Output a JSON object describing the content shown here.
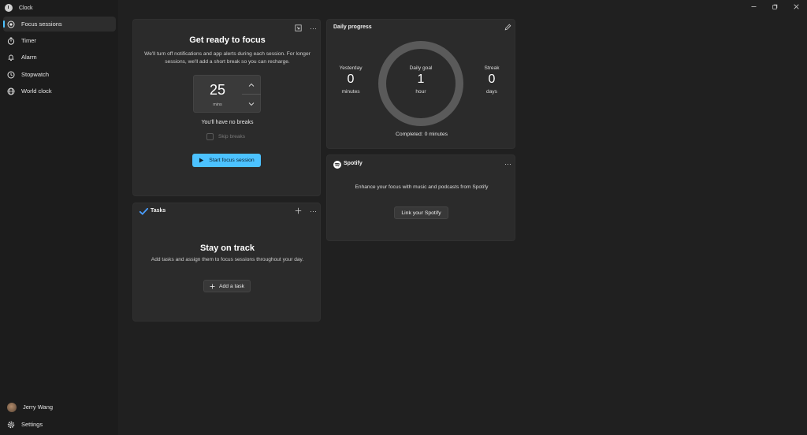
{
  "app": {
    "title": "Clock"
  },
  "sidebar": {
    "items": [
      {
        "label": "Focus sessions",
        "active": true,
        "icon": "focus-icon"
      },
      {
        "label": "Timer",
        "active": false,
        "icon": "timer-icon"
      },
      {
        "label": "Alarm",
        "active": false,
        "icon": "alarm-bell-icon"
      },
      {
        "label": "Stopwatch",
        "active": false,
        "icon": "stopwatch-icon"
      },
      {
        "label": "World clock",
        "active": false,
        "icon": "globe-icon"
      }
    ],
    "user": {
      "name": "Jerry Wang"
    },
    "settings_label": "Settings"
  },
  "focus": {
    "heading": "Get ready to focus",
    "description": "We'll turn off notifications and app alerts during each session. For longer sessions, we'll add a short break so you can recharge.",
    "duration_value": "25",
    "duration_unit": "mins",
    "breaks_text": "You'll have no breaks",
    "skip_breaks_label": "Skip breaks",
    "skip_breaks_checked": false,
    "start_label": "Start focus session"
  },
  "tasks": {
    "title": "Tasks",
    "heading": "Stay on track",
    "description": "Add tasks and assign them to focus sessions throughout your day.",
    "add_label": "Add a task"
  },
  "progress": {
    "title": "Daily progress",
    "yesterday": {
      "label": "Yesterday",
      "value": "0",
      "unit": "minutes"
    },
    "goal": {
      "label": "Daily goal",
      "value": "1",
      "unit": "hour"
    },
    "streak": {
      "label": "Streak",
      "value": "0",
      "unit": "days"
    },
    "completed_text": "Completed: 0 minutes",
    "completion_fraction": 0
  },
  "spotify": {
    "title": "Spotify",
    "description": "Enhance your focus with music and podcasts from Spotify",
    "link_label": "Link your Spotify"
  },
  "colors": {
    "accent": "#4cc2ff",
    "background": "#202020",
    "card": "#2b2b2b",
    "spotify_green": "#ffffff"
  }
}
